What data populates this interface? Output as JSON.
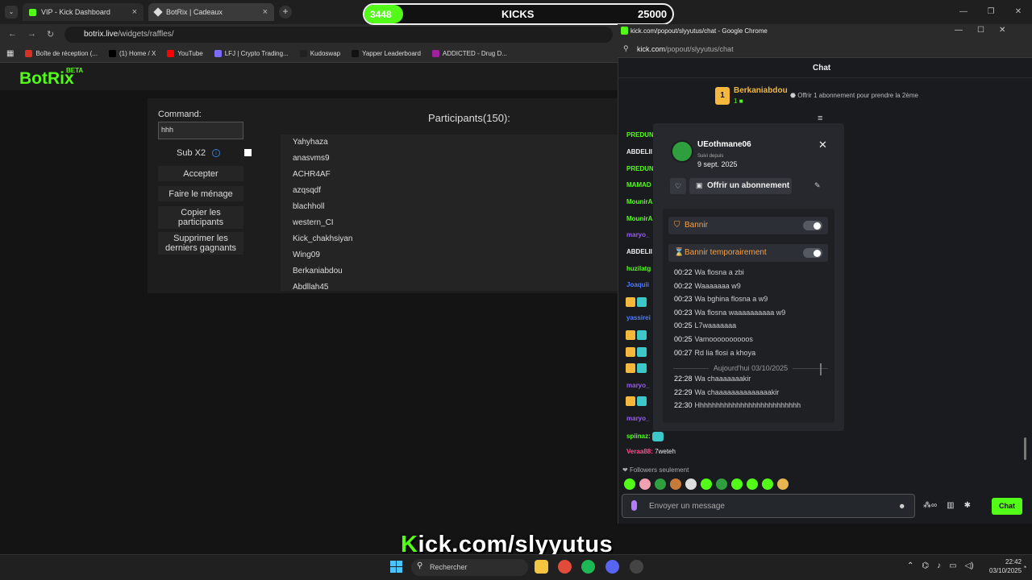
{
  "browser": {
    "tabs": [
      {
        "title": "VIP - Kick Dashboard"
      },
      {
        "title": "BotRix | Cadeaux"
      }
    ],
    "address": {
      "host": "botrix.live",
      "path": "/widgets/raffles/"
    },
    "bookmarks": [
      {
        "label": "Boîte de réception (...",
        "color": "#d93025"
      },
      {
        "label": "(1) Home / X",
        "color": "#000000"
      },
      {
        "label": "YouTube",
        "color": "#ff0000"
      },
      {
        "label": "LFJ | Crypto Trading...",
        "color": "#7b6cff"
      },
      {
        "label": "Kudoswap",
        "color": "#222222"
      },
      {
        "label": "Yapper Leaderboard",
        "color": "#111111"
      },
      {
        "label": "ADDICTED - Drug D...",
        "color": "#a020a0"
      }
    ]
  },
  "botrix": {
    "logo": "BotRix",
    "beta": "BETA",
    "command_label": "Command:",
    "command_value": "hhh",
    "subx2_label": "Sub X2",
    "buttons": {
      "accept": "Accepter",
      "clean": "Faire le ménage",
      "copy": "Copier les participants",
      "remove": "Supprimer les derniers gagnants"
    },
    "participants_title": "Participants(150):",
    "participants": [
      "Yahyhaza",
      "anasvms9",
      "ACHR4AF",
      "azqsqdf",
      "blachholl",
      "western_CI",
      "Kick_chakhsiyan",
      "Wing09",
      "Berkaniabdou",
      "Abdllah45"
    ]
  },
  "kicks_goal": {
    "current": "3448",
    "label": "KICKS",
    "goal": "25000",
    "progress_fraction": 0.138,
    "color": "#53fc18"
  },
  "popup": {
    "window_title": "kick.com/popout/slyyutus/chat - Google Chrome",
    "url_host": "kick.com",
    "url_path": "/popout/slyyutus/chat",
    "chat_title": "Chat",
    "gift": {
      "rank": "1",
      "user": "Berkaniabdou",
      "count": "1",
      "text": "Offrir 1 abonnement pour prendre la 2ème"
    },
    "chat_names": [
      {
        "name": "PREDUN",
        "color": "#53fc18"
      },
      {
        "name": "ABDELII",
        "color": "#eeeeee"
      },
      {
        "name": "PREDUN",
        "color": "#53fc18"
      },
      {
        "name": "MAMAD",
        "color": "#53fc18"
      },
      {
        "name": "MounirA",
        "color": "#53fc18"
      },
      {
        "name": "MounirA",
        "color": "#53fc18"
      },
      {
        "name": "maryo_",
        "color": "#9b5cf6"
      },
      {
        "name": "ABDELII",
        "color": "#eeeeee"
      },
      {
        "name": "huzilatg",
        "color": "#53fc18"
      },
      {
        "name": "Joaquii",
        "color": "#4f7cff"
      },
      {
        "name": "yassirei",
        "color": "#4f7cff"
      },
      {
        "name": "maryo_",
        "color": "#9b5cf6"
      },
      {
        "name": "maryo_",
        "color": "#9b5cf6"
      }
    ],
    "messages": [
      {
        "user": "spiinaz:",
        "user_color": "#53fc18",
        "text": ""
      },
      {
        "user": "Veraa88:",
        "user_color": "#ff4d8d",
        "text": "7weteh"
      }
    ],
    "followers_only": "Followers seulement",
    "input_placeholder": "Envoyer un message",
    "send_label": "Chat",
    "usercard": {
      "name": "UEothmane06",
      "since_label": "Suivi depuis",
      "since_date": "9 sept. 2025",
      "gift_label": "Offrir un abonnement",
      "ban_label": "Bannir",
      "timeout_label": "Bannir temporairement",
      "log": [
        {
          "time": "00:22",
          "text": "Wa flosna a zbi"
        },
        {
          "time": "00:22",
          "text": "Waaaaaaa w9"
        },
        {
          "time": "00:23",
          "text": "Wa bghina flosna a w9"
        },
        {
          "time": "00:23",
          "text": "Wa flosna waaaaaaaaaa w9"
        },
        {
          "time": "00:25",
          "text": "L7waaaaaaa"
        },
        {
          "time": "00:25",
          "text": "Vamoooooooooos"
        },
        {
          "time": "00:27",
          "text": "Rd lia flosi a khoya"
        }
      ],
      "separator": "Aujourd'hui 03/10/2025",
      "log_today": [
        {
          "time": "22:28",
          "text": "Wa chaaaaaaakir"
        },
        {
          "time": "22:29",
          "text": "Wa chaaaaaaaaaaaaaakir"
        },
        {
          "time": "22:30",
          "text": "Hhhhhhhhhhhhhhhhhhhhhhhhhh"
        }
      ]
    }
  },
  "overlay": {
    "prefix": "K",
    "text": "ick.com/slyyutus"
  },
  "taskbar": {
    "search_placeholder": "Rechercher",
    "time": "22:42",
    "date": "03/10/2025"
  }
}
